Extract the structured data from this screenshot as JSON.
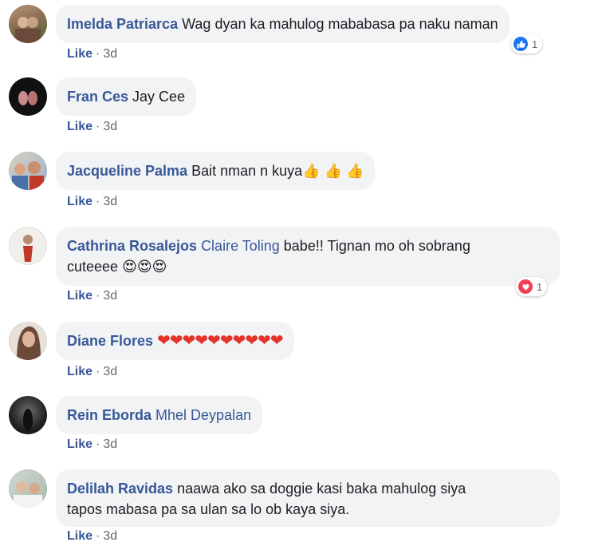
{
  "comments": [
    {
      "author": "Imelda Patriarca",
      "text": "Wag dyan ka mahulog mababasa pa naku naman",
      "like_label": "Like",
      "time": "3d",
      "reaction": {
        "type": "like-icon",
        "count": "1",
        "color": "#1877f2"
      }
    },
    {
      "author": "Fran Ces",
      "text": "Jay Cee",
      "like_label": "Like",
      "time": "3d"
    },
    {
      "author": "Jacqueline Palma",
      "text": "Bait nman n kuya",
      "emoji": "👍 👍 👍",
      "like_label": "Like",
      "time": "3d"
    },
    {
      "author": "Cathrina Rosalejos",
      "tag": "Claire Toling",
      "text": " babe!! Tignan mo oh sobrang",
      "text2": "cuteeee",
      "emoji": "😍😍😍",
      "like_label": "Like",
      "time": "3d",
      "reaction": {
        "type": "love-icon",
        "count": "1",
        "color": "#f33e58"
      }
    },
    {
      "author": "Diane Flores",
      "hearts": "❤❤❤❤❤❤❤❤❤❤",
      "like_label": "Like",
      "time": "3d"
    },
    {
      "author": "Rein Eborda",
      "tag": "Mhel Deypalan",
      "like_label": "Like",
      "time": "3d"
    },
    {
      "author": "Delilah Ravidas",
      "text": "naawa ako sa doggie kasi baka mahulog siya",
      "text2": "tapos mabasa pa sa ulan sa lo ob kaya siya.",
      "like_label": "Like",
      "time": "3d"
    }
  ],
  "meta_separator": "·"
}
